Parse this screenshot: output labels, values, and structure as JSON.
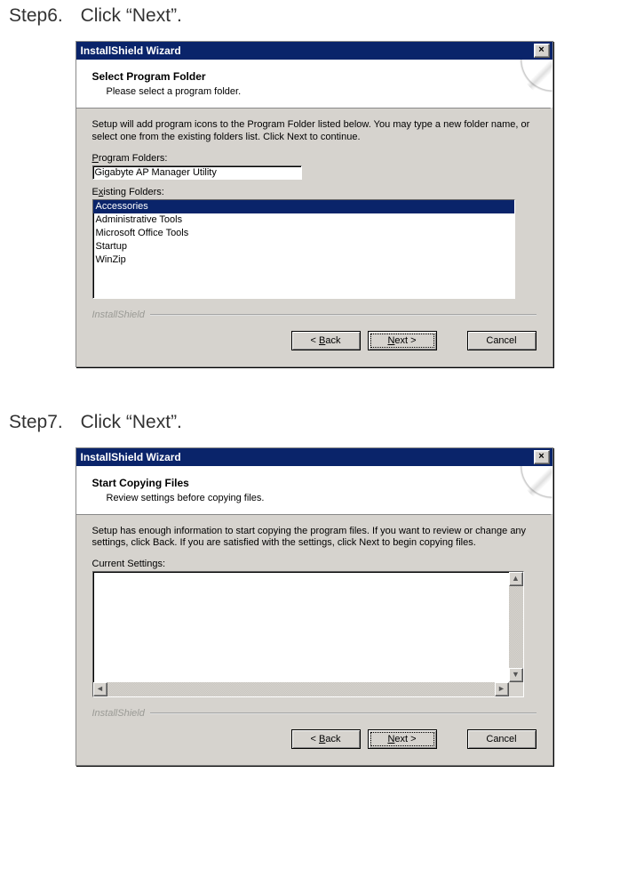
{
  "step6": {
    "caption_step": "Step6.",
    "caption_text": "Click “Next”.",
    "title": "InstallShield Wizard",
    "header_title": "Select Program Folder",
    "header_subtitle": "Please select a program folder.",
    "instruction": "Setup will add program icons to the Program Folder listed below.  You may type a new folder name, or select one from the existing folders list.  Click Next to continue.",
    "program_folders_label": "Program Folders:",
    "program_folder_value": "Gigabyte AP Manager Utility",
    "existing_folders_label": "Existing Folders:",
    "existing_folders": [
      {
        "label": "Accessories",
        "selected": true
      },
      {
        "label": "Administrative Tools",
        "selected": false
      },
      {
        "label": "Microsoft Office Tools",
        "selected": false
      },
      {
        "label": "Startup",
        "selected": false
      },
      {
        "label": "WinZip",
        "selected": false
      }
    ],
    "brand": "InstallShield",
    "buttons": {
      "back": "< Back",
      "next": "Next >",
      "cancel": "Cancel"
    }
  },
  "step7": {
    "caption_step": "Step7.",
    "caption_text": "Click “Next”.",
    "title": "InstallShield Wizard",
    "header_title": "Start Copying Files",
    "header_subtitle": "Review settings before copying files.",
    "instruction": "Setup has enough information to start copying the program files.  If you want to review or change any settings, click Back.  If you are satisfied with the settings, click Next to begin copying files.",
    "current_settings_label": "Current Settings:",
    "brand": "InstallShield",
    "buttons": {
      "back": "< Back",
      "next": "Next >",
      "cancel": "Cancel"
    }
  }
}
